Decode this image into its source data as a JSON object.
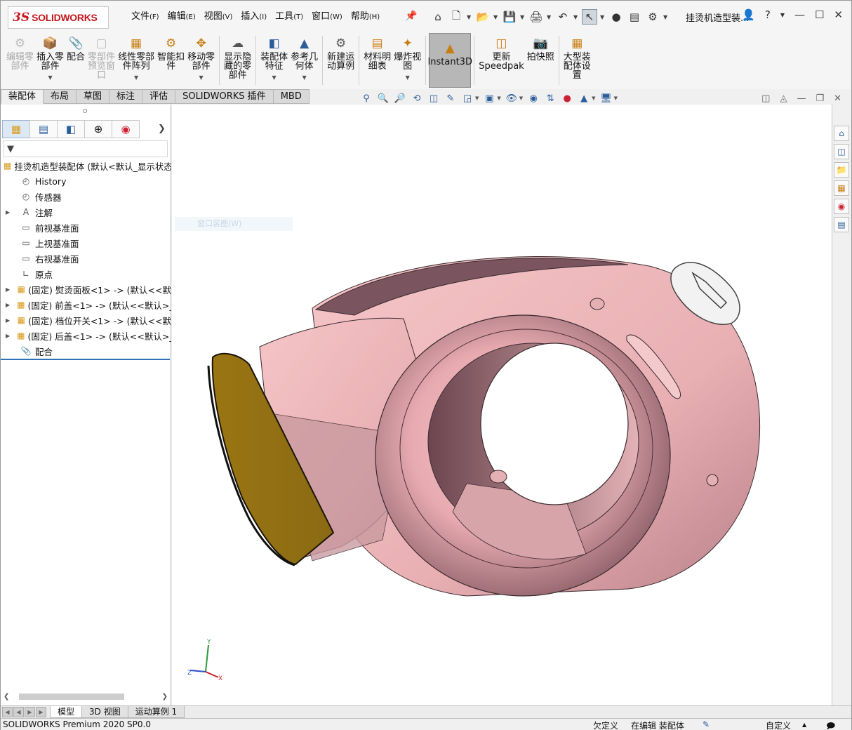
{
  "app": {
    "brand_ds": "3S",
    "brand_name": "SOLIDWORKS",
    "document_title": "挂烫机造型装..."
  },
  "menu": [
    {
      "label": "文件",
      "key": "(F)"
    },
    {
      "label": "编辑",
      "key": "(E)"
    },
    {
      "label": "视图",
      "key": "(V)"
    },
    {
      "label": "插入",
      "key": "(I)"
    },
    {
      "label": "工具",
      "key": "(T)"
    },
    {
      "label": "窗口",
      "key": "(W)"
    },
    {
      "label": "帮助",
      "key": "(H)"
    }
  ],
  "commands": [
    {
      "label": "编辑零\n部件",
      "disabled": true
    },
    {
      "label": "插入零\n部件",
      "caret": true
    },
    {
      "label": "配合"
    },
    {
      "label": "零部件\n预览窗\n口",
      "disabled": true
    },
    {
      "label": "线性零部\n件阵列",
      "caret": true
    },
    {
      "label": "智能扣\n件"
    },
    {
      "label": "移动零\n部件",
      "caret": true
    },
    {
      "label": "显示隐\n藏的零\n部件"
    },
    {
      "label": "装配体\n特征",
      "caret": true
    },
    {
      "label": "参考几\n何体",
      "caret": true
    },
    {
      "label": "新建运\n动算例"
    },
    {
      "label": "材料明\n细表"
    },
    {
      "label": "爆炸视\n图",
      "caret": true
    },
    {
      "label": "Instant3D",
      "active": true
    },
    {
      "label": "更新\nSpeedpak"
    },
    {
      "label": "拍快照"
    },
    {
      "label": "大型装\n配体设\n置"
    }
  ],
  "tabs": [
    "装配体",
    "布局",
    "草图",
    "标注",
    "评估",
    "SOLIDWORKS 插件",
    "MBD"
  ],
  "tree": {
    "root": "挂烫机造型装配体 (默认<默认_显示状态",
    "items": [
      {
        "label": "History",
        "expand": false
      },
      {
        "label": "传感器",
        "expand": false
      },
      {
        "label": "注解",
        "expand": true
      },
      {
        "label": "前视基准面",
        "expand": false
      },
      {
        "label": "上视基准面",
        "expand": false
      },
      {
        "label": "右视基准面",
        "expand": false
      },
      {
        "label": "原点",
        "expand": false
      },
      {
        "label": "(固定) 熨烫面板<1> -> (默认<<默",
        "expand": true
      },
      {
        "label": "(固定) 前盖<1> -> (默认<<默认>_",
        "expand": true
      },
      {
        "label": "(固定) 档位开关<1> -> (默认<<默",
        "expand": true
      },
      {
        "label": "(固定) 后盖<1> -> (默认<<默认>_",
        "expand": true
      },
      {
        "label": "配合",
        "expand": false
      }
    ]
  },
  "viewport": {
    "ghost_text": "窗口装图(W)"
  },
  "triad": {
    "x": "X",
    "y": "Y",
    "z": "Z"
  },
  "bottom_tabs": [
    "模型",
    "3D 视图",
    "运动算例 1"
  ],
  "status": {
    "product": "SOLIDWORKS Premium 2020 SP0.0",
    "underdefined": "欠定义",
    "editing": "在编辑 装配体",
    "custom": "自定义"
  },
  "colors": {
    "body": "#e8b2b4",
    "shade": "#6e4a52",
    "panel": "#8c6a14",
    "accent": "#c4161c"
  }
}
